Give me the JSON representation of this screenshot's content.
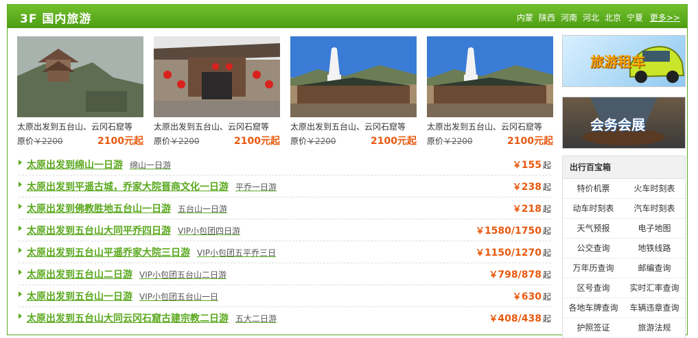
{
  "header": {
    "title": "3F 国内旅游",
    "links": [
      "内蒙",
      "陕西",
      "河南",
      "河北",
      "北京",
      "宁夏"
    ],
    "more": "更多>>"
  },
  "thumbs": [
    {
      "caption": "太原出发到五台山、云冈石窟等",
      "orig_label": "原价",
      "orig_price": "￥2200",
      "price": "2100元起"
    },
    {
      "caption": "太原出发到五台山、云冈石窟等",
      "orig_label": "原价",
      "orig_price": "￥2200",
      "price": "2100元起"
    },
    {
      "caption": "太原出发到五台山、云冈石窟等",
      "orig_label": "原价",
      "orig_price": "￥2200",
      "price": "2100元起"
    },
    {
      "caption": "太原出发到五台山、云冈石窟等",
      "orig_label": "原价",
      "orig_price": "￥2200",
      "price": "2100元起"
    }
  ],
  "tours": [
    {
      "title": "太原出发到绵山一日游",
      "sub": "绵山一日游",
      "yen": "￥",
      "price": "155",
      "qi": "起"
    },
    {
      "title": "太原出发到平遥古城，乔家大院晋商文化一日游",
      "sub": "平乔一日游",
      "yen": "￥",
      "price": "238",
      "qi": "起"
    },
    {
      "title": "太原出发到佛教胜地五台山一日游",
      "sub": "五台山一日游",
      "yen": "￥",
      "price": "218",
      "qi": "起"
    },
    {
      "title": "太原出发到五台山大同平乔四日游",
      "sub": "VIP小包团四日游",
      "yen": "￥",
      "price": "1580/1750",
      "qi": "起"
    },
    {
      "title": "太原出发到五台山平遥乔家大院三日游",
      "sub": "VIP小包团五平乔三日",
      "yen": "￥",
      "price": "1150/1270",
      "qi": "起"
    },
    {
      "title": "太原出发到五台山二日游",
      "sub": "VIP小包团五台山二日游",
      "yen": "￥",
      "price": "798/878",
      "qi": "起"
    },
    {
      "title": "太原出发到五台山一日游",
      "sub": "VIP小包团五台山一日",
      "yen": "￥",
      "price": "630",
      "qi": "起"
    },
    {
      "title": "太原出发到五台山大同云冈石窟古建宗教二日游",
      "sub": "五大二日游",
      "yen": "￥",
      "price": "408/438",
      "qi": "起"
    }
  ],
  "banners": {
    "car": "旅游租车",
    "meeting": "会务会展"
  },
  "toolbox": {
    "title": "出行百宝箱",
    "items": [
      "特价机票",
      "火车时刻表",
      "动车时刻表",
      "汽车时刻表",
      "天气预报",
      "电子地图",
      "公交查询",
      "地铁线路",
      "万年历查询",
      "邮编查询",
      "区号查询",
      "实时汇率查询",
      "各地车牌查询",
      "车辆违章查询",
      "护照签证",
      "旅游法规"
    ]
  },
  "colors": {
    "green": "#5aa81e",
    "price": "#e8590f"
  }
}
